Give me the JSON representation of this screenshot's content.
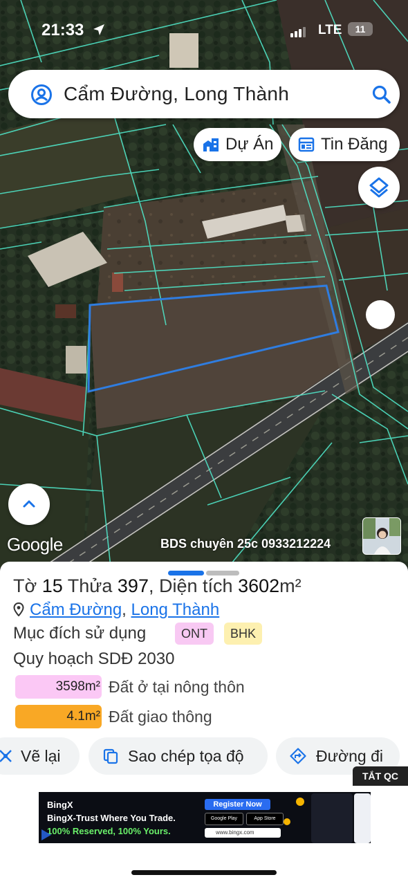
{
  "status_bar": {
    "time": "21:33",
    "network": "LTE",
    "battery": "11"
  },
  "search": {
    "query": "Cẩm Đường, Long Thành"
  },
  "chips": {
    "projects": "Dự Án",
    "listings": "Tin Đăng"
  },
  "map": {
    "google_logo": "Google",
    "watermark": "BDS chuyên 25c 0933212224"
  },
  "parcel": {
    "sheet_label": "Tờ",
    "sheet_no": "15",
    "lot_label": "Thửa",
    "lot_no": "397",
    "area_label": "Diện tích",
    "area_value": "3602",
    "area_unit": "m²",
    "commune": "Cẩm Đường",
    "district": "Long Thành",
    "purpose_label": "Mục đích sử dụng",
    "purpose_badges": [
      "ONT",
      "BHK"
    ],
    "plan_label": "Quy hoạch SDĐ 2030",
    "zones": [
      {
        "area": "3598m²",
        "desc": "Đất ở tại nông thôn"
      },
      {
        "area": "4.1m²",
        "desc": "Đất giao thông"
      }
    ]
  },
  "actions": {
    "redraw": "Vẽ lại",
    "copy_coords": "Sao chép tọa độ",
    "directions": "Đường đi"
  },
  "ad": {
    "close_label": "TẮT QC",
    "brand": "BingX",
    "headline": "BingX-Trust Where You Trade.",
    "subline": "100% Reserved, 100% Yours.",
    "cta": "Register Now",
    "google_play": "Google Play",
    "app_store": "App Store",
    "url": "www.bingx.com"
  },
  "colors": {
    "accent": "#1a73e8",
    "parcel_outline": "#2f7de0",
    "cadastral": "#4fe3c6",
    "badge_ont": "#f8c9f3",
    "badge_bhk": "#fdf0b0",
    "zone_residential": "#fbc8f5",
    "zone_traffic": "#f9a825"
  }
}
